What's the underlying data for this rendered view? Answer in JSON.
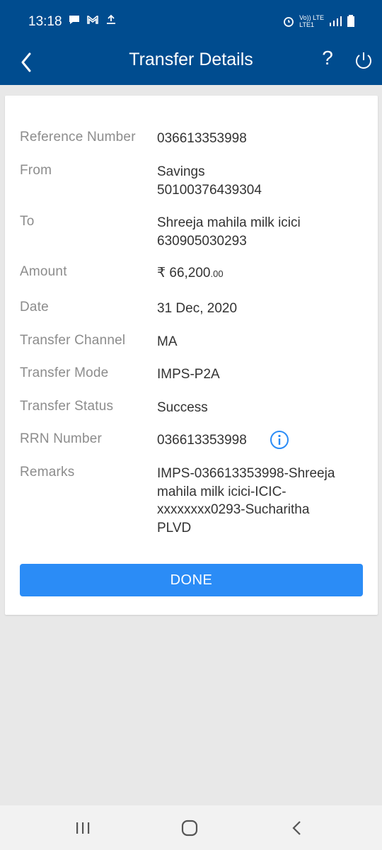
{
  "status_bar": {
    "time": "13:18",
    "left_icons": [
      "message-icon",
      "gmail-icon",
      "upload-icon"
    ],
    "right_icons": [
      "alarm-icon",
      "volte-icon",
      "signal-icon",
      "battery-icon"
    ],
    "volte_label": "Vo)) LTE",
    "lte_label": "LTE1"
  },
  "header": {
    "title": "Transfer Details",
    "help_label": "?",
    "accent_color": "#004c8f"
  },
  "details": [
    {
      "label": "Reference Number",
      "value": [
        "036613353998"
      ]
    },
    {
      "label": "From",
      "value": [
        "Savings",
        "50100376439304"
      ]
    },
    {
      "label": "To",
      "value": [
        "Shreeja mahila milk icici",
        "630905030293"
      ]
    },
    {
      "label": "Amount",
      "currency": "₹",
      "amount_main": "66,200",
      "amount_decimal": ".00"
    },
    {
      "label": "Date",
      "value": [
        "31 Dec, 2020"
      ]
    },
    {
      "label": "Transfer Channel",
      "value": [
        "MA"
      ]
    },
    {
      "label": "Transfer Mode",
      "value": [
        "IMPS-P2A"
      ]
    },
    {
      "label": "Transfer Status",
      "value": [
        "Success"
      ]
    },
    {
      "label": "RRN Number",
      "value": [
        "036613353998"
      ]
    },
    {
      "label": "Remarks",
      "value": [
        "IMPS-036613353998-Shreeja",
        "mahila milk icici-ICIC-",
        "xxxxxxxx0293-Sucharitha",
        "PLVD"
      ]
    }
  ],
  "done_button": {
    "label": "DONE",
    "color": "#2b8cf6"
  },
  "nav_bar": {
    "items": [
      "recent-apps-icon",
      "home-icon",
      "back-icon"
    ]
  }
}
